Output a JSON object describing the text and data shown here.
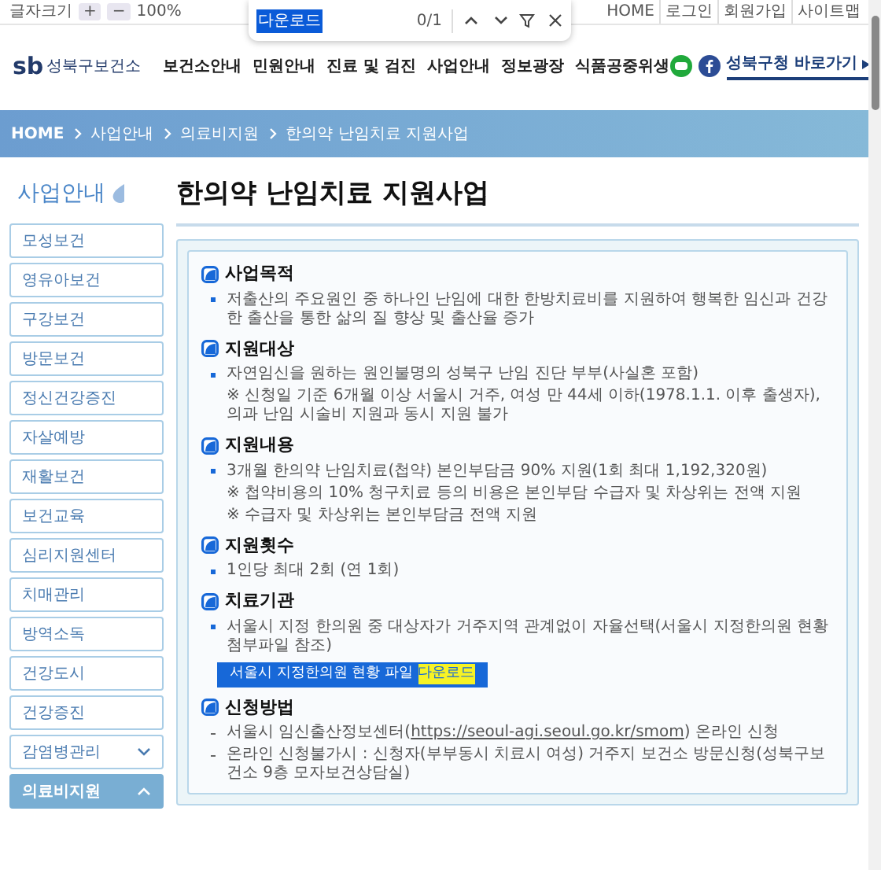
{
  "toolbar": {
    "font_size_label": "글자크기",
    "zoom_in": "+",
    "zoom_out": "−",
    "zoom": "100%",
    "links": [
      "HOME",
      "로그인",
      "회원가입",
      "사이트맵"
    ]
  },
  "find_bar": {
    "query": "다운로드",
    "count": "0/1"
  },
  "header": {
    "logo_mark": "sb",
    "logo_text": "성북구보건소",
    "nav": [
      "보건소안내",
      "민원안내",
      "진료 및 검진",
      "사업안내",
      "정보광장",
      "식품공중위생"
    ],
    "shortcut": "성북구청 바로가기"
  },
  "breadcrumb": [
    "HOME",
    "사업안내",
    "의료비지원",
    "한의약 난임치료 지원사업"
  ],
  "sidebar": {
    "title": "사업안내",
    "items": [
      {
        "label": "모성보건",
        "kind": "link",
        "selected": false
      },
      {
        "label": "영유아보건",
        "kind": "link",
        "selected": false
      },
      {
        "label": "구강보건",
        "kind": "link",
        "selected": false
      },
      {
        "label": "방문보건",
        "kind": "link",
        "selected": false
      },
      {
        "label": "정신건강증진",
        "kind": "link",
        "selected": false
      },
      {
        "label": "자살예방",
        "kind": "link",
        "selected": false
      },
      {
        "label": "재활보건",
        "kind": "link",
        "selected": false
      },
      {
        "label": "보건교육",
        "kind": "link",
        "selected": false
      },
      {
        "label": "심리지원센터",
        "kind": "link",
        "selected": false
      },
      {
        "label": "치매관리",
        "kind": "link",
        "selected": false
      },
      {
        "label": "방역소독",
        "kind": "link",
        "selected": false
      },
      {
        "label": "건강도시",
        "kind": "link",
        "selected": false
      },
      {
        "label": "건강증진",
        "kind": "link",
        "selected": false
      },
      {
        "label": "감염병관리",
        "kind": "group",
        "selected": false,
        "expanded": false
      },
      {
        "label": "의료비지원",
        "kind": "group",
        "selected": true,
        "expanded": true
      }
    ]
  },
  "page_title": "한의약 난임치료 지원사업",
  "sections": [
    {
      "heading": "사업목적",
      "items": [
        {
          "kind": "bullet",
          "parts": [
            {
              "text": "저출산의 주요원인 중 하나인 난임에 대한 한방치료비를 지원하여 행복한 임신과 건강한 출산을 통한 삶의 질 향상 및 출산율 증가"
            }
          ]
        }
      ]
    },
    {
      "heading": "지원대상",
      "items": [
        {
          "kind": "bullet",
          "parts": [
            {
              "text": "자연임신을 원하는 원인불명의 성북구 난임 진단 부부(사실혼 포함)"
            }
          ]
        },
        {
          "kind": "note",
          "parts": [
            {
              "text": "※ 신청일 기준 6개월 이상 서울시 거주, 여성 만 44세 이하(1978.1.1. 이후 출생자), 의과  난임 시술비 지원과 동시 지원 불가"
            }
          ]
        }
      ]
    },
    {
      "heading": "지원내용",
      "items": [
        {
          "kind": "bullet",
          "parts": [
            {
              "text": "3개월 한의약 난임치료(첩약) 본인부담금 90% 지원(1회 최대 1,192,320원)"
            }
          ]
        },
        {
          "kind": "note",
          "parts": [
            {
              "text": "※ 첩약비용의 10% 청구치료 등의 비용은 본인부담 수급자 및 차상위는 전액 지원"
            }
          ]
        },
        {
          "kind": "note",
          "parts": [
            {
              "text": "※ 수급자 및 차상위는 본인부담금 전액 지원"
            }
          ]
        }
      ]
    },
    {
      "heading": "지원횟수",
      "items": [
        {
          "kind": "bullet",
          "parts": [
            {
              "text": "1인당 최대 2회 (연 1회)"
            }
          ]
        }
      ]
    },
    {
      "heading": "치료기관",
      "items": [
        {
          "kind": "bullet",
          "parts": [
            {
              "text": "서울시 지정 한의원 중 대상자가 거주지역 관계없이 자율선택(서울시 지정한의원 현황 첨부파일 참조)"
            }
          ]
        }
      ],
      "button": {
        "label": "서울시 지정한의원 현황 파일",
        "highlight": "다운로드"
      }
    },
    {
      "heading": "신청방법",
      "items": [
        {
          "kind": "dash",
          "parts": [
            {
              "text": "서울시 임신출산정보센터("
            },
            {
              "text": "https://seoul-agi.seoul.go.kr/smom",
              "link": true
            },
            {
              "text": ") 온라인 신청"
            }
          ]
        },
        {
          "kind": "dash",
          "parts": [
            {
              "text": "온라인 신청불가시 : 신청자(부부동시 치료시 여성) 거주지 보건소 방문신청(성북구보건소 9층 모자보건상담실)"
            }
          ]
        }
      ]
    }
  ]
}
